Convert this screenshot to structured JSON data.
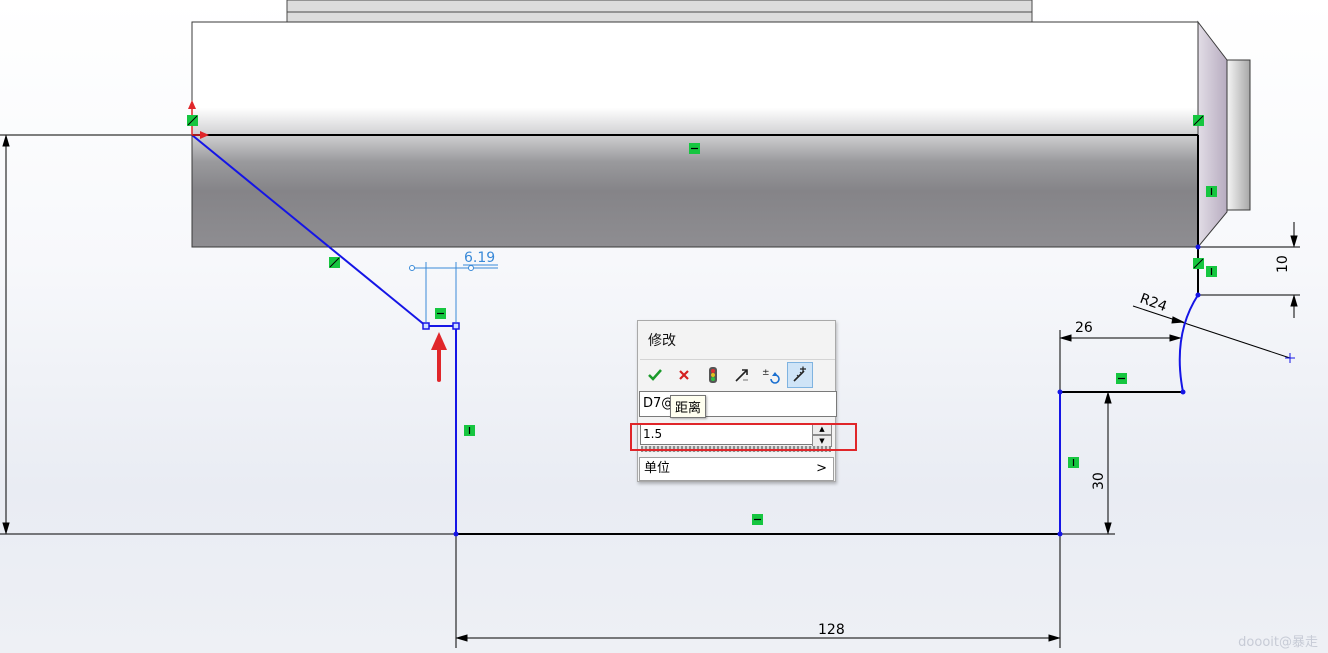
{
  "dimensions": {
    "d_6_19": "6.19",
    "d_10": "10",
    "d_r24": "R24",
    "d_26": "26",
    "d_30": "30",
    "d_128": "128"
  },
  "modify_dialog": {
    "title": "修改",
    "dimension_name": "D7@",
    "tooltip": "距离",
    "value": "1.5",
    "units_label": "单位",
    "units_arrow": ">",
    "spin_up": "▲",
    "spin_down": "▼"
  },
  "colors": {
    "sketch_line": "#1515e6",
    "relation_marker": "#16c640",
    "highlight": "#e0262a",
    "dimension_preview": "#3a8ad8"
  },
  "watermark": "doooit@暴走"
}
